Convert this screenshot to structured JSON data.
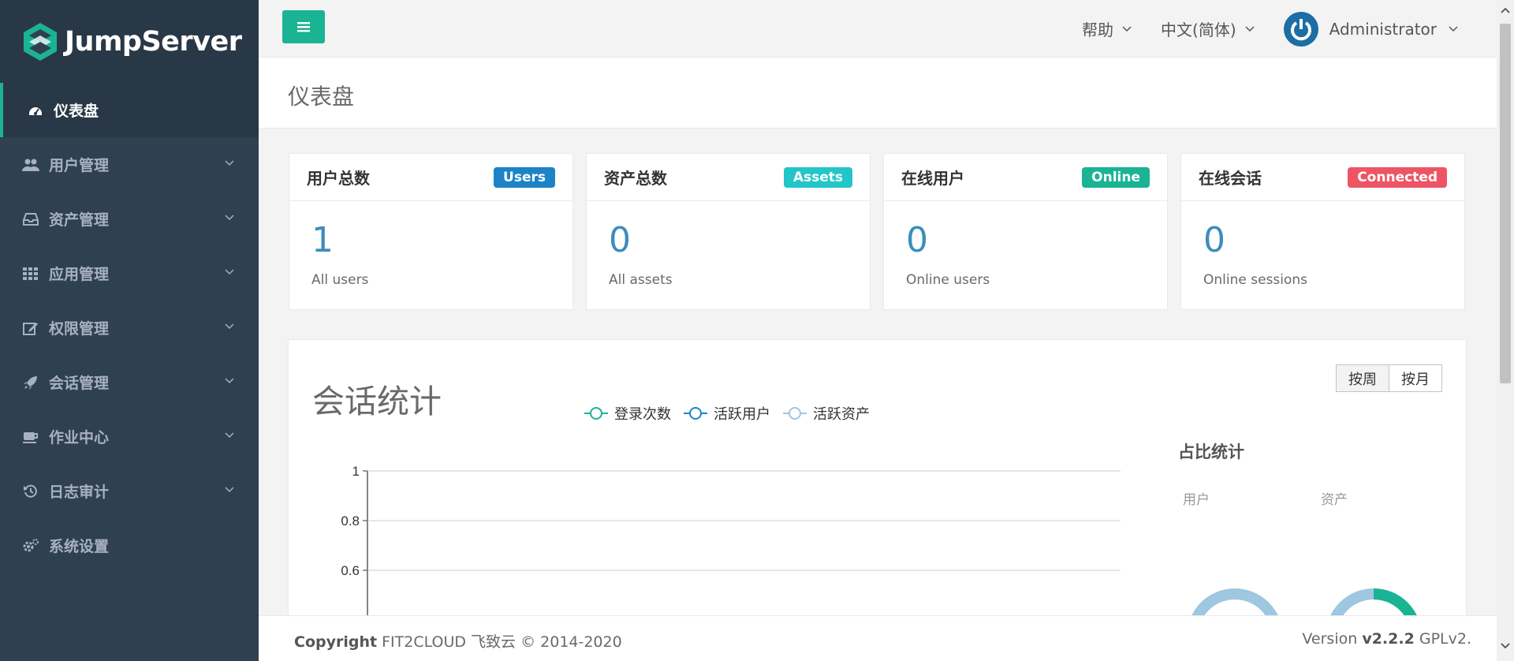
{
  "brand": {
    "name": "JumpServer"
  },
  "sidebar": {
    "items": [
      {
        "label": "仪表盘",
        "icon": "dashboard-icon",
        "active": true
      },
      {
        "label": "用户管理",
        "icon": "users-icon",
        "has_children": true
      },
      {
        "label": "资产管理",
        "icon": "inbox-icon",
        "has_children": true
      },
      {
        "label": "应用管理",
        "icon": "grid-icon",
        "has_children": true
      },
      {
        "label": "权限管理",
        "icon": "edit-icon",
        "has_children": true
      },
      {
        "label": "会话管理",
        "icon": "rocket-icon",
        "has_children": true
      },
      {
        "label": "作业中心",
        "icon": "coffee-icon",
        "has_children": true
      },
      {
        "label": "日志审计",
        "icon": "history-icon",
        "has_children": true
      },
      {
        "label": "系统设置",
        "icon": "gears-icon"
      }
    ]
  },
  "topbar": {
    "help": "帮助",
    "language": "中文(简体)",
    "user": "Administrator"
  },
  "page": {
    "title": "仪表盘"
  },
  "cards": [
    {
      "title": "用户总数",
      "badge": "Users",
      "badge_color": "#1c84c6",
      "value": "1",
      "sub": "All users"
    },
    {
      "title": "资产总数",
      "badge": "Assets",
      "badge_color": "#23c6c8",
      "value": "0",
      "sub": "All assets"
    },
    {
      "title": "在线用户",
      "badge": "Online",
      "badge_color": "#1ab394",
      "value": "0",
      "sub": "Online users"
    },
    {
      "title": "在线会话",
      "badge": "Connected",
      "badge_color": "#ed5565",
      "value": "0",
      "sub": "Online sessions"
    }
  ],
  "session_stats": {
    "title": "会话统计",
    "btn_week": "按周",
    "btn_month": "按月",
    "ratio_title": "占比统计",
    "ratio_user": "用户",
    "ratio_asset": "资产"
  },
  "chart_data": {
    "type": "line",
    "series": [
      {
        "name": "登录次数",
        "color": "#1ab394",
        "values": []
      },
      {
        "name": "活跃用户",
        "color": "#1c84c6",
        "values": []
      },
      {
        "name": "活跃资产",
        "color": "#9ec7e0",
        "values": []
      }
    ],
    "y_ticks": [
      "1",
      "0.8",
      "0.6"
    ],
    "ylim": [
      0,
      1
    ],
    "grid": true,
    "legend": "top-center"
  },
  "footer": {
    "copyright_label": "Copyright",
    "copyright_text": "FIT2CLOUD 飞致云 © 2014-2020",
    "version_label": "Version",
    "version_number": "v2.2.2",
    "license": "GPLv2."
  },
  "colors": {
    "accent": "#1ab394",
    "sidebar": "#2f4050",
    "link": "#3c8dbc"
  }
}
